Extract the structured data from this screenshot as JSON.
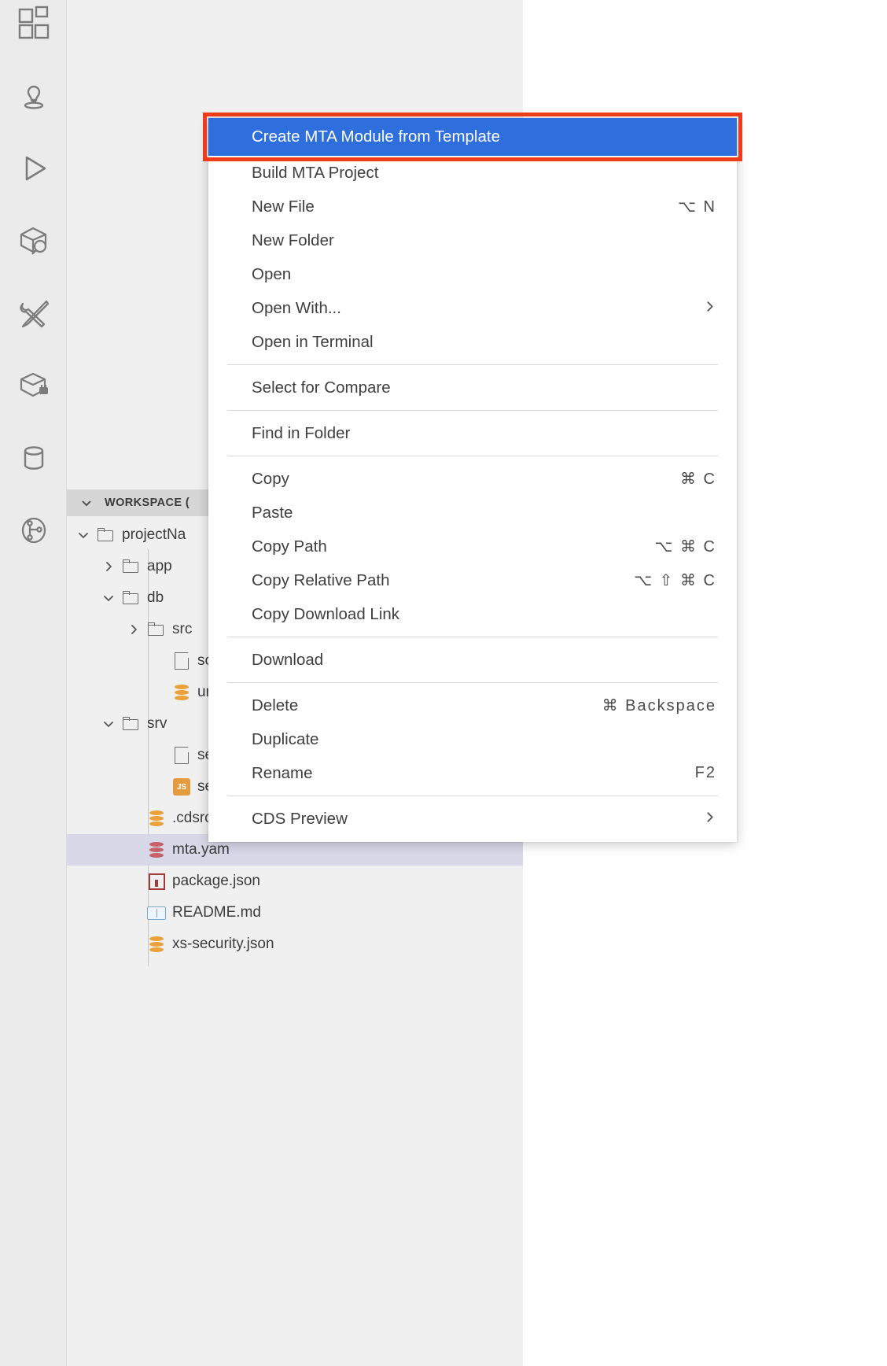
{
  "activity_bar": {
    "items": [
      {
        "name": "extensions-icon",
        "title": "Extensions"
      },
      {
        "name": "cloud-foundry-icon",
        "title": "Cloud Foundry"
      },
      {
        "name": "run-icon",
        "title": "Run Configurations"
      },
      {
        "name": "package-explorer-icon",
        "title": "Package Explorer"
      },
      {
        "name": "tools-icon",
        "title": "Tools"
      },
      {
        "name": "deploy-package-icon",
        "title": "Deploy"
      },
      {
        "name": "database-icon",
        "title": "Database Explorer"
      },
      {
        "name": "source-control-icon",
        "title": "Source Control"
      }
    ]
  },
  "explorer": {
    "workspace_label": "WORKSPACE (",
    "tree": [
      {
        "label": "projectNa",
        "icon": "folder",
        "twisty": "down",
        "indent": 0,
        "selected": false
      },
      {
        "label": "app",
        "icon": "folder",
        "twisty": "right",
        "indent": 1,
        "selected": false
      },
      {
        "label": "db",
        "icon": "folder",
        "twisty": "down",
        "indent": 1,
        "selected": false
      },
      {
        "label": "src",
        "icon": "folder",
        "twisty": "right",
        "indent": 2,
        "selected": false
      },
      {
        "label": "schema",
        "icon": "file",
        "twisty": "none",
        "indent": 3,
        "selected": false
      },
      {
        "label": "undepl",
        "icon": "db-orange",
        "twisty": "none",
        "indent": 3,
        "selected": false
      },
      {
        "label": "srv",
        "icon": "folder",
        "twisty": "down",
        "indent": 1,
        "selected": false
      },
      {
        "label": "service",
        "icon": "file",
        "twisty": "none",
        "indent": 3,
        "selected": false
      },
      {
        "label": "service",
        "icon": "js",
        "twisty": "none",
        "indent": 3,
        "selected": false
      },
      {
        "label": ".cdsrc.js",
        "icon": "db-orange",
        "twisty": "none",
        "indent": 2,
        "selected": false
      },
      {
        "label": "mta.yam",
        "icon": "db-red",
        "twisty": "none",
        "indent": 2,
        "selected": true
      },
      {
        "label": "package.json",
        "icon": "npm",
        "twisty": "none",
        "indent": 2,
        "selected": false
      },
      {
        "label": "README.md",
        "icon": "md",
        "twisty": "none",
        "indent": 2,
        "selected": false
      },
      {
        "label": "xs-security.json",
        "icon": "db-orange",
        "twisty": "none",
        "indent": 2,
        "selected": false
      }
    ]
  },
  "context_menu": {
    "items": [
      {
        "label": "Create MTA Module from Template",
        "shortcut": "",
        "submenu": false,
        "highlighted": true
      },
      {
        "label": "Build MTA Project",
        "shortcut": "",
        "submenu": false,
        "highlighted": false
      },
      {
        "label": "New File",
        "shortcut": "⌥ N",
        "submenu": false,
        "highlighted": false
      },
      {
        "label": "New Folder",
        "shortcut": "",
        "submenu": false,
        "highlighted": false
      },
      {
        "label": "Open",
        "shortcut": "",
        "submenu": false,
        "highlighted": false
      },
      {
        "label": "Open With...",
        "shortcut": "",
        "submenu": true,
        "highlighted": false
      },
      {
        "label": "Open in Terminal",
        "shortcut": "",
        "submenu": false,
        "highlighted": false
      },
      {
        "separator": true
      },
      {
        "label": "Select for Compare",
        "shortcut": "",
        "submenu": false,
        "highlighted": false
      },
      {
        "separator": true
      },
      {
        "label": "Find in Folder",
        "shortcut": "",
        "submenu": false,
        "highlighted": false
      },
      {
        "separator": true
      },
      {
        "label": "Copy",
        "shortcut": "⌘ C",
        "submenu": false,
        "highlighted": false
      },
      {
        "label": "Paste",
        "shortcut": "",
        "submenu": false,
        "highlighted": false
      },
      {
        "label": "Copy Path",
        "shortcut": "⌥ ⌘ C",
        "submenu": false,
        "highlighted": false
      },
      {
        "label": "Copy Relative Path",
        "shortcut": "⌥ ⇧ ⌘ C",
        "submenu": false,
        "highlighted": false
      },
      {
        "label": "Copy Download Link",
        "shortcut": "",
        "submenu": false,
        "highlighted": false
      },
      {
        "separator": true
      },
      {
        "label": "Download",
        "shortcut": "",
        "submenu": false,
        "highlighted": false
      },
      {
        "separator": true
      },
      {
        "label": "Delete",
        "shortcut": "⌘ Backspace",
        "submenu": false,
        "highlighted": false
      },
      {
        "label": "Duplicate",
        "shortcut": "",
        "submenu": false,
        "highlighted": false
      },
      {
        "label": "Rename",
        "shortcut": "F2",
        "submenu": false,
        "highlighted": false
      },
      {
        "separator": true
      },
      {
        "label": "CDS Preview",
        "shortcut": "",
        "submenu": true,
        "highlighted": false
      }
    ]
  },
  "annotation": {
    "target_label": "Create MTA Module from Template",
    "color": "#ef3b17"
  },
  "colors": {
    "menu_highlight": "#2f6fdd",
    "annotation_red": "#ef3b17",
    "panel_bg": "#f0f0f0",
    "activity_bg": "#ebebeb",
    "selection_bg": "#d8d8e8",
    "workspace_header_bg": "#d6d6d6"
  }
}
